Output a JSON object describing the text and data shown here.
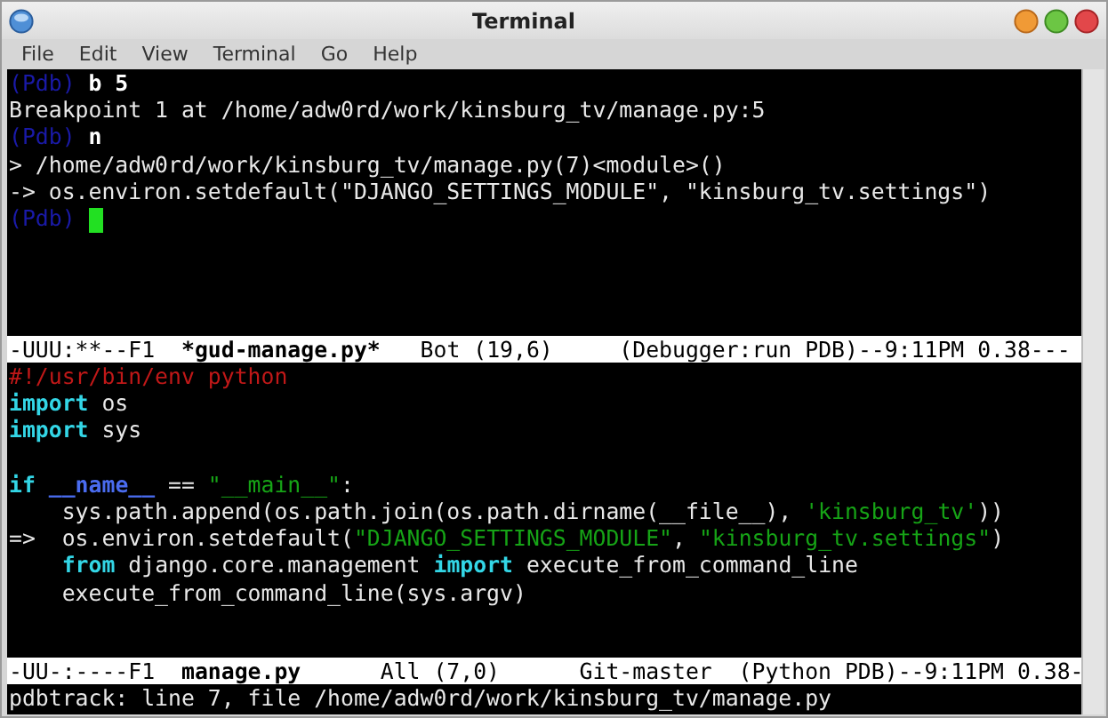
{
  "window": {
    "title": "Terminal"
  },
  "menu": [
    "File",
    "Edit",
    "View",
    "Terminal",
    "Go",
    "Help"
  ],
  "top_pane": {
    "lines": [
      {
        "segments": [
          {
            "text": "(Pdb) ",
            "kind": "prompt"
          },
          {
            "text": "b 5",
            "kind": "input"
          }
        ]
      },
      {
        "segments": [
          {
            "text": "Breakpoint 1 at /home/adw0rd/work/kinsburg_tv/manage.py:5",
            "kind": "plain"
          }
        ]
      },
      {
        "segments": [
          {
            "text": "(Pdb) ",
            "kind": "prompt"
          },
          {
            "text": "n",
            "kind": "input"
          }
        ]
      },
      {
        "segments": [
          {
            "text": "> /home/adw0rd/work/kinsburg_tv/manage.py(7)<module>()",
            "kind": "plain"
          }
        ]
      },
      {
        "segments": [
          {
            "text": "-> os.environ.setdefault(\"DJANGO_SETTINGS_MODULE\", \"kinsburg_tv.settings\")",
            "kind": "plain"
          }
        ]
      },
      {
        "segments": [
          {
            "text": "(Pdb) ",
            "kind": "prompt"
          }
        ],
        "cursor": true
      }
    ],
    "mode_line": [
      {
        "text": "-UUU:**--F1  ",
        "kind": "plain"
      },
      {
        "text": "*gud-manage.py*",
        "kind": "buffer"
      },
      {
        "text": "   Bot (19,6)     (Debugger:run PDB)--9:11PM 0.38---",
        "kind": "plain"
      }
    ]
  },
  "bottom_pane": {
    "lines": [
      {
        "segments": [
          {
            "text": "#!/usr/bin/env python",
            "kind": "comment"
          }
        ]
      },
      {
        "segments": [
          {
            "text": "import",
            "kind": "keyword"
          },
          {
            "text": " os",
            "kind": "plain"
          }
        ]
      },
      {
        "segments": [
          {
            "text": "import",
            "kind": "keyword"
          },
          {
            "text": " sys",
            "kind": "plain"
          }
        ]
      },
      {
        "segments": [
          {
            "text": "if ",
            "kind": "keyword"
          },
          {
            "text": "__name__",
            "kind": "builtin"
          },
          {
            "text": " == ",
            "kind": "plain"
          },
          {
            "text": "\"__main__\"",
            "kind": "string"
          },
          {
            "text": ":",
            "kind": "plain"
          }
        ],
        "blank_before": true
      },
      {
        "segments": [
          {
            "text": "    sys.path.append(os.path.join(os.path.dirname(__file__), ",
            "kind": "plain"
          },
          {
            "text": "'kinsburg_tv'",
            "kind": "string"
          },
          {
            "text": "))",
            "kind": "plain"
          }
        ]
      },
      {
        "segments": [
          {
            "text": "=>  os.environ.setdefault(",
            "kind": "plain"
          },
          {
            "text": "\"DJANGO_SETTINGS_MODULE\"",
            "kind": "string"
          },
          {
            "text": ", ",
            "kind": "plain"
          },
          {
            "text": "\"kinsburg_tv.settings\"",
            "kind": "string"
          },
          {
            "text": ")",
            "kind": "plain"
          }
        ]
      },
      {
        "segments": [
          {
            "text": "    from",
            "kind": "keyword"
          },
          {
            "text": " django.core.management ",
            "kind": "plain"
          },
          {
            "text": "import",
            "kind": "keyword"
          },
          {
            "text": " execute_from_command_line",
            "kind": "plain"
          }
        ]
      },
      {
        "segments": [
          {
            "text": "    execute_from_command_line(sys.argv)",
            "kind": "plain"
          }
        ]
      }
    ],
    "mode_line": [
      {
        "text": "-UU-:----F1  ",
        "kind": "plain"
      },
      {
        "text": "manage.py",
        "kind": "buffer"
      },
      {
        "text": "      All (7,0)      Git-master  (Python PDB)--9:11PM 0.38-",
        "kind": "plain"
      }
    ]
  },
  "echo_area": "pdbtrack: line 7, file /home/adw0rd/work/kinsburg_tv/manage.py"
}
